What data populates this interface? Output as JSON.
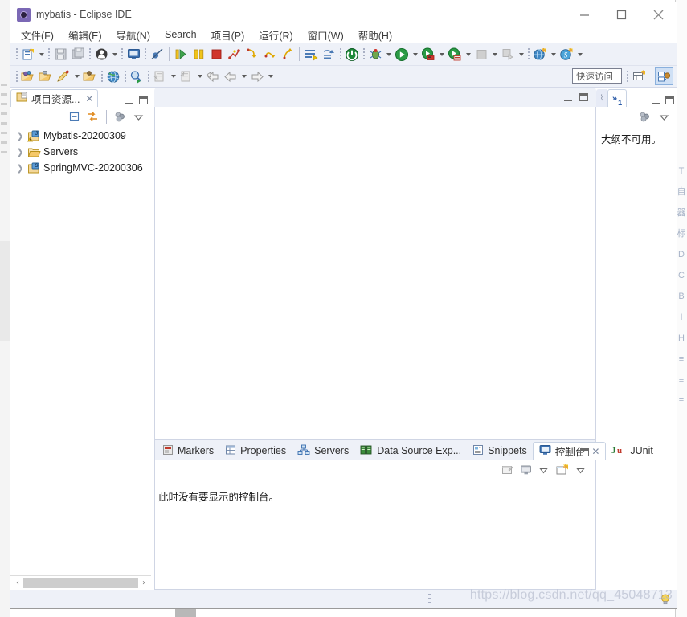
{
  "window": {
    "title": "mybatis - Eclipse IDE",
    "app_icon": "eclipse-icon",
    "controls": {
      "minimize": "minimize-icon",
      "maximize": "maximize-icon",
      "close": "close-icon"
    }
  },
  "menubar": {
    "items": [
      {
        "label": "文件(F)",
        "name": "menu-file"
      },
      {
        "label": "编辑(E)",
        "name": "menu-edit"
      },
      {
        "label": "导航(N)",
        "name": "menu-navigate"
      },
      {
        "label": "Search",
        "name": "menu-search"
      },
      {
        "label": "项目(P)",
        "name": "menu-project"
      },
      {
        "label": "运行(R)",
        "name": "menu-run"
      },
      {
        "label": "窗口(W)",
        "name": "menu-window"
      },
      {
        "label": "帮助(H)",
        "name": "menu-help"
      }
    ]
  },
  "toolbar": {
    "quick_access_placeholder": "快速访问",
    "row1": [
      "new-icon",
      "save-icon",
      "save-all-icon",
      "user-icon",
      "console-view-icon",
      "toggle-breakpoint-icon",
      "resume-icon",
      "suspend-icon",
      "terminate-icon",
      "disconnect-icon",
      "step-into-icon",
      "step-over-icon",
      "step-return-icon",
      "run-last-tool-icon",
      "external-tools-icon",
      "power-icon",
      "debug-icon",
      "run-icon",
      "run-server-icon",
      "run-server-db-icon",
      "stop-icon",
      "stop-all-icon",
      "new-web-icon",
      "new-spring-icon"
    ],
    "row2": [
      "open-type-icon",
      "open-resource-icon",
      "pencil-icon",
      "open-task-icon",
      "globe-icon",
      "search-icon",
      "next-annotation-icon",
      "previous-annotation-icon",
      "back-icon",
      "forward-icon"
    ]
  },
  "project_explorer": {
    "tab_label": "项目资源...",
    "tab_icon": "project-explorer-icon",
    "toolbar": [
      "collapse-all-icon",
      "link-with-editor-icon",
      "view-menu-icon",
      "view-dropdown-icon"
    ],
    "tree": [
      {
        "label": "Mybatis-20200309",
        "icon": "java-project-warning-icon",
        "expanded": false
      },
      {
        "label": "Servers",
        "icon": "folder-icon",
        "expanded": false
      },
      {
        "label": "SpringMVC-20200306",
        "icon": "java-project-spring-icon",
        "expanded": false
      }
    ],
    "scrollbar": {
      "left_arrow": "‹",
      "right_arrow": "›"
    }
  },
  "outline": {
    "tab_label": "»",
    "tab_badge": "1",
    "message": "大纲不可用。",
    "toolbar": [
      "view-menu-icon",
      "view-dropdown-icon"
    ]
  },
  "bottom_panel": {
    "tabs": [
      {
        "label": "Markers",
        "icon": "markers-icon",
        "active": false
      },
      {
        "label": "Properties",
        "icon": "properties-icon",
        "active": false
      },
      {
        "label": "Servers",
        "icon": "servers-icon",
        "active": false
      },
      {
        "label": "Data Source Exp...",
        "icon": "data-source-icon",
        "active": false
      },
      {
        "label": "Snippets",
        "icon": "snippets-icon",
        "active": false
      },
      {
        "label": "控制台",
        "icon": "console-icon",
        "active": true
      },
      {
        "label": "JUnit",
        "icon": "junit-icon",
        "active": false
      }
    ],
    "console_message": "此时没有要显示的控制台。",
    "toolbar": [
      "open-console-icon",
      "display-selected-console-icon",
      "console-dropdown-icon",
      "new-console-icon",
      "new-console-dropdown-icon"
    ]
  },
  "statusbar": {
    "resize_grip": "resize-grip",
    "bulb": "tip-bulb-icon"
  },
  "watermark": {
    "text": "https://blog.csdn.net/qq_45048713"
  }
}
